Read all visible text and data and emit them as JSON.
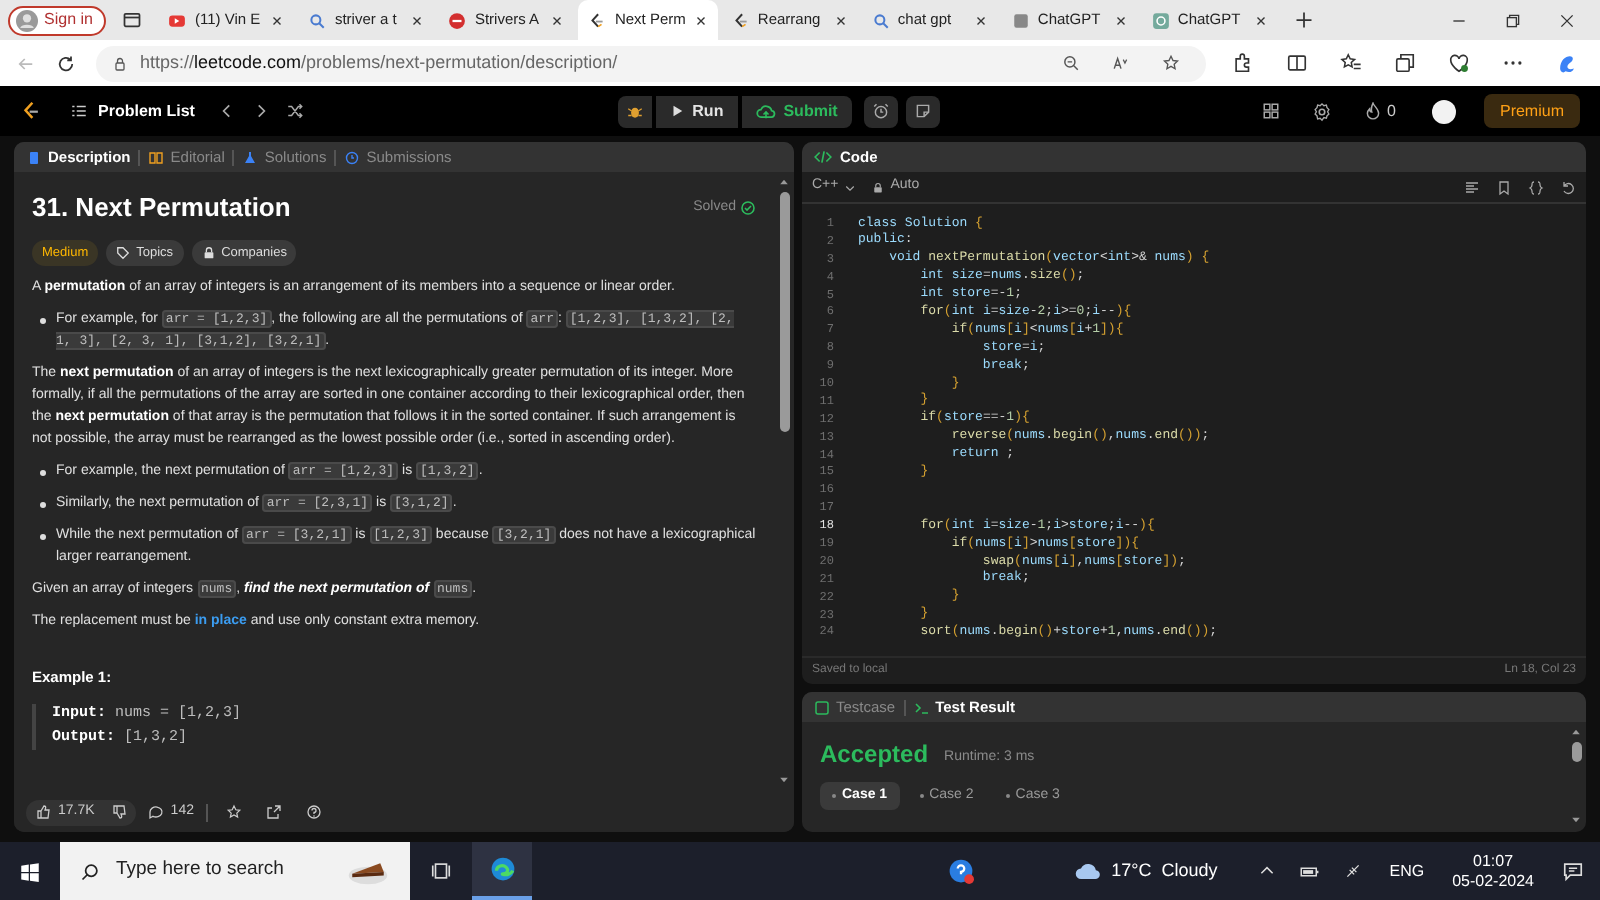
{
  "browser": {
    "profile_button": "Sign in",
    "tabs": [
      {
        "label": "(11) Vin E",
        "selected": false
      },
      {
        "label": "striver a t",
        "selected": false
      },
      {
        "label": "Strivers A",
        "selected": false
      },
      {
        "label": "Next Perm",
        "selected": true
      },
      {
        "label": "Rearrang",
        "selected": false
      },
      {
        "label": "chat gpt",
        "selected": false
      },
      {
        "label": "ChatGPT",
        "selected": false
      },
      {
        "label": "ChatGPT",
        "selected": false
      }
    ],
    "url_scheme": "https://",
    "url_host": "leetcode.com",
    "url_path": "/problems/next-permutation/description/"
  },
  "nav": {
    "problem_list": "Problem List",
    "run": "Run",
    "submit": "Submit",
    "streak": "0",
    "premium": "Premium"
  },
  "description_panel": {
    "tabs": [
      {
        "label": "Description",
        "selected": true
      },
      {
        "label": "Editorial",
        "selected": false
      },
      {
        "label": "Solutions",
        "selected": false
      },
      {
        "label": "Submissions",
        "selected": false
      }
    ],
    "title": "31. Next Permutation",
    "status": "Solved",
    "difficulty": "Medium",
    "topics": "Topics",
    "companies": "Companies",
    "blocks": [
      {
        "kind": "paragraph",
        "segments": [
          {
            "kind": "text",
            "text": "A "
          },
          {
            "kind": "bold",
            "text": "permutation"
          },
          {
            "kind": "text",
            "text": " of an array of integers is an arrangement of its members into a sequence or linear order."
          }
        ]
      },
      {
        "kind": "bullet",
        "segments": [
          {
            "kind": "text",
            "text": "For example, for "
          },
          {
            "kind": "code",
            "text": "arr = [1,2,3]"
          },
          {
            "kind": "text",
            "text": ", the following are all the permutations of "
          },
          {
            "kind": "code",
            "text": "arr"
          },
          {
            "kind": "text",
            "text": ": "
          },
          {
            "kind": "code",
            "text": "[1,2,3], [1,3,2], [2, 1, 3], [2, 3, 1], [3,1,2], [3,2,1]"
          },
          {
            "kind": "text",
            "text": "."
          }
        ]
      },
      {
        "kind": "paragraph",
        "segments": [
          {
            "kind": "text",
            "text": "The "
          },
          {
            "kind": "bold",
            "text": "next permutation"
          },
          {
            "kind": "text",
            "text": " of an array of integers is the next lexicographically greater permutation of its integer. More formally, if all the permutations of the array are sorted in one container according to their lexicographical order, then the "
          },
          {
            "kind": "bold",
            "text": "next permutation"
          },
          {
            "kind": "text",
            "text": " of that array is the permutation that follows it in the sorted container. If such arrangement is not possible, the array must be rearranged as the lowest possible order (i.e., sorted in ascending order)."
          }
        ]
      },
      {
        "kind": "bullet",
        "segments": [
          {
            "kind": "text",
            "text": "For example, the next permutation of "
          },
          {
            "kind": "code",
            "text": "arr = [1,2,3]"
          },
          {
            "kind": "text",
            "text": " is "
          },
          {
            "kind": "code",
            "text": "[1,3,2]"
          },
          {
            "kind": "text",
            "text": "."
          }
        ]
      },
      {
        "kind": "bullet",
        "segments": [
          {
            "kind": "text",
            "text": "Similarly, the next permutation of "
          },
          {
            "kind": "code",
            "text": "arr = [2,3,1]"
          },
          {
            "kind": "text",
            "text": " is "
          },
          {
            "kind": "code",
            "text": "[3,1,2]"
          },
          {
            "kind": "text",
            "text": "."
          }
        ]
      },
      {
        "kind": "bullet",
        "segments": [
          {
            "kind": "text",
            "text": "While the next permutation of "
          },
          {
            "kind": "code",
            "text": "arr = [3,2,1]"
          },
          {
            "kind": "text",
            "text": " is "
          },
          {
            "kind": "code",
            "text": "[1,2,3]"
          },
          {
            "kind": "text",
            "text": " because "
          },
          {
            "kind": "code",
            "text": "[3,2,1]"
          },
          {
            "kind": "text",
            "text": " does not have a lexicographical larger rearrangement."
          }
        ]
      },
      {
        "kind": "paragraph",
        "segments": [
          {
            "kind": "text",
            "text": "Given an array of integers "
          },
          {
            "kind": "code",
            "text": "nums"
          },
          {
            "kind": "text",
            "text": ", "
          },
          {
            "kind": "italic",
            "text": "find the next permutation of "
          },
          {
            "kind": "code",
            "text": "nums"
          },
          {
            "kind": "text",
            "text": "."
          }
        ]
      },
      {
        "kind": "paragraph",
        "segments": [
          {
            "kind": "text",
            "text": "The replacement must be "
          },
          {
            "kind": "link",
            "text": "in place"
          },
          {
            "kind": "text",
            "text": " and use only constant extra memory."
          }
        ]
      },
      {
        "kind": "heading",
        "text": "Example 1:"
      },
      {
        "kind": "example",
        "lines": [
          {
            "label": "Input:",
            "value": "nums = [1,2,3]"
          },
          {
            "label": "Output:",
            "value": "[1,3,2]"
          }
        ]
      }
    ],
    "likes": "17.7K",
    "comments": "142"
  },
  "code_panel": {
    "title": "Code",
    "language": "C++",
    "mode": "Auto",
    "lines": [
      {
        "number": "1",
        "text": "class Solution {",
        "active": false
      },
      {
        "number": "2",
        "text": "public:",
        "active": false
      },
      {
        "number": "3",
        "text": "    void nextPermutation(vector<int>& nums) {",
        "active": false
      },
      {
        "number": "4",
        "text": "        int size=nums.size();",
        "active": false
      },
      {
        "number": "5",
        "text": "        int store=-1;",
        "active": false
      },
      {
        "number": "6",
        "text": "        for(int i=size-2;i>=0;i--){",
        "active": false
      },
      {
        "number": "7",
        "text": "            if(nums[i]<nums[i+1]){",
        "active": false
      },
      {
        "number": "8",
        "text": "                store=i;",
        "active": false
      },
      {
        "number": "9",
        "text": "                break;",
        "active": false
      },
      {
        "number": "10",
        "text": "            }",
        "active": false
      },
      {
        "number": "11",
        "text": "        }",
        "active": false
      },
      {
        "number": "12",
        "text": "        if(store==-1){",
        "active": false
      },
      {
        "number": "13",
        "text": "            reverse(nums.begin(),nums.end());",
        "active": false
      },
      {
        "number": "14",
        "text": "            return ;",
        "active": false
      },
      {
        "number": "15",
        "text": "        }",
        "active": false
      },
      {
        "number": "16",
        "active": false
      },
      {
        "number": "17",
        "active": false
      },
      {
        "number": "18",
        "text": "        for(int i=size-1;i>store;i--){",
        "active": true
      },
      {
        "number": "19",
        "text": "            if(nums[i]>nums[store]){",
        "active": false
      },
      {
        "number": "20",
        "text": "                swap(nums[i],nums[store]);",
        "active": false
      },
      {
        "number": "21",
        "text": "                break;",
        "active": false
      },
      {
        "number": "22",
        "text": "            }",
        "active": false
      },
      {
        "number": "23",
        "text": "        }",
        "active": false
      },
      {
        "number": "24",
        "text": "        sort(nums.begin()+store+1,nums.end());",
        "active": false
      }
    ],
    "saved": "Saved to local",
    "cursor": "Ln 18, Col 23"
  },
  "result_panel": {
    "tabs": [
      {
        "label": "Testcase",
        "selected": false
      },
      {
        "label": "Test Result",
        "selected": true
      }
    ],
    "verdict": "Accepted",
    "runtime": "Runtime: 3 ms",
    "cases": [
      {
        "label": "Case 1",
        "selected": true
      },
      {
        "label": "Case 2",
        "selected": false
      },
      {
        "label": "Case 3",
        "selected": false
      }
    ]
  },
  "taskbar": {
    "search_placeholder": "Type here to search",
    "weather": "17°C  Cloudy",
    "language": "ENG",
    "time": "01:07",
    "date": "05-02-2024"
  }
}
